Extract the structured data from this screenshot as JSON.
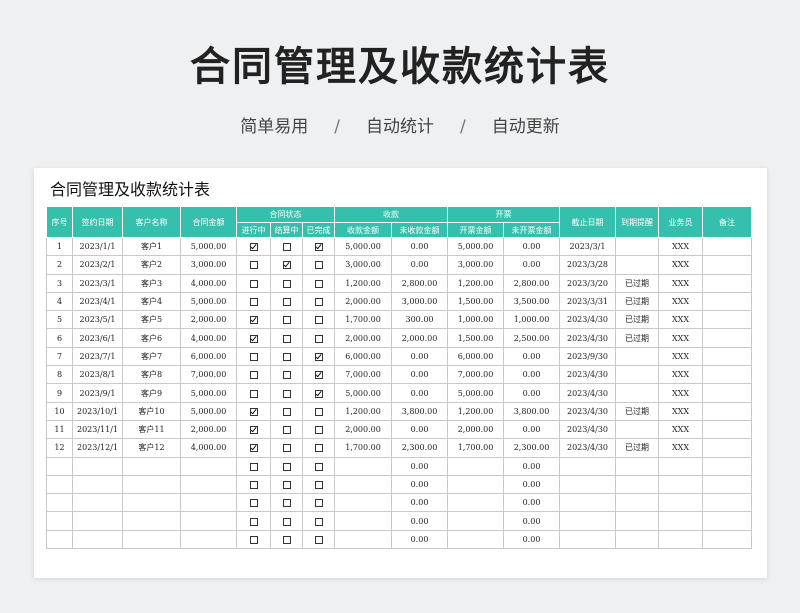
{
  "hero": {
    "title": "合同管理及收款统计表",
    "subtitle_items": [
      "简单易用",
      "自动统计",
      "自动更新"
    ],
    "separator": "/"
  },
  "sheet": {
    "title": "合同管理及收款统计表",
    "headers": {
      "seq": "序号",
      "sign_date": "签约日期",
      "customer": "客户名称",
      "contract_amount": "合同金额",
      "status_group": "合同状态",
      "status_in_progress": "进行中",
      "status_settling": "结算中",
      "status_done": "已完成",
      "receipt_group": "收款",
      "receipt_amount": "收款金额",
      "receipt_outstanding": "未收款金额",
      "invoice_group": "开票",
      "invoice_amount": "开票金额",
      "invoice_outstanding": "未开票金额",
      "deadline": "截止日期",
      "reminder": "到期提醒",
      "salesperson": "业务员",
      "remark": "备注"
    },
    "rows": [
      {
        "seq": "1",
        "date": "2023/1/1",
        "customer": "客户1",
        "amount": "5,000.00",
        "in_progress": true,
        "settling": false,
        "done": true,
        "received": "5,000.00",
        "unreceived": "0.00",
        "invoiced": "5,000.00",
        "uninvoiced": "0.00",
        "deadline": "2023/3/1",
        "reminder": "",
        "sales": "XXX",
        "remark": ""
      },
      {
        "seq": "2",
        "date": "2023/2/1",
        "customer": "客户2",
        "amount": "3,000.00",
        "in_progress": false,
        "settling": true,
        "done": false,
        "received": "3,000.00",
        "unreceived": "0.00",
        "invoiced": "3,000.00",
        "uninvoiced": "0.00",
        "deadline": "2023/3/28",
        "reminder": "",
        "sales": "XXX",
        "remark": ""
      },
      {
        "seq": "3",
        "date": "2023/3/1",
        "customer": "客户3",
        "amount": "4,000.00",
        "in_progress": false,
        "settling": false,
        "done": false,
        "received": "1,200.00",
        "unreceived": "2,800.00",
        "invoiced": "1,200.00",
        "uninvoiced": "2,800.00",
        "deadline": "2023/3/20",
        "reminder": "已过期",
        "sales": "XXX",
        "remark": ""
      },
      {
        "seq": "4",
        "date": "2023/4/1",
        "customer": "客户4",
        "amount": "5,000.00",
        "in_progress": false,
        "settling": false,
        "done": false,
        "received": "2,000.00",
        "unreceived": "3,000.00",
        "invoiced": "1,500.00",
        "uninvoiced": "3,500.00",
        "deadline": "2023/3/31",
        "reminder": "已过期",
        "sales": "XXX",
        "remark": ""
      },
      {
        "seq": "5",
        "date": "2023/5/1",
        "customer": "客户5",
        "amount": "2,000.00",
        "in_progress": true,
        "settling": false,
        "done": false,
        "received": "1,700.00",
        "unreceived": "300.00",
        "invoiced": "1,000.00",
        "uninvoiced": "1,000.00",
        "deadline": "2023/4/30",
        "reminder": "已过期",
        "sales": "XXX",
        "remark": ""
      },
      {
        "seq": "6",
        "date": "2023/6/1",
        "customer": "客户6",
        "amount": "4,000.00",
        "in_progress": true,
        "settling": false,
        "done": false,
        "received": "2,000.00",
        "unreceived": "2,000.00",
        "invoiced": "1,500.00",
        "uninvoiced": "2,500.00",
        "deadline": "2023/4/30",
        "reminder": "已过期",
        "sales": "XXX",
        "remark": ""
      },
      {
        "seq": "7",
        "date": "2023/7/1",
        "customer": "客户7",
        "amount": "6,000.00",
        "in_progress": false,
        "settling": false,
        "done": true,
        "received": "6,000.00",
        "unreceived": "0.00",
        "invoiced": "6,000.00",
        "uninvoiced": "0.00",
        "deadline": "2023/9/30",
        "reminder": "",
        "sales": "XXX",
        "remark": ""
      },
      {
        "seq": "8",
        "date": "2023/8/1",
        "customer": "客户8",
        "amount": "7,000.00",
        "in_progress": false,
        "settling": false,
        "done": true,
        "received": "7,000.00",
        "unreceived": "0.00",
        "invoiced": "7,000.00",
        "uninvoiced": "0.00",
        "deadline": "2023/4/30",
        "reminder": "",
        "sales": "XXX",
        "remark": ""
      },
      {
        "seq": "9",
        "date": "2023/9/1",
        "customer": "客户9",
        "amount": "5,000.00",
        "in_progress": false,
        "settling": false,
        "done": true,
        "received": "5,000.00",
        "unreceived": "0.00",
        "invoiced": "5,000.00",
        "uninvoiced": "0.00",
        "deadline": "2023/4/30",
        "reminder": "",
        "sales": "XXX",
        "remark": ""
      },
      {
        "seq": "10",
        "date": "2023/10/1",
        "customer": "客户10",
        "amount": "5,000.00",
        "in_progress": true,
        "settling": false,
        "done": false,
        "received": "1,200.00",
        "unreceived": "3,800.00",
        "invoiced": "1,200.00",
        "uninvoiced": "3,800.00",
        "deadline": "2023/4/30",
        "reminder": "已过期",
        "sales": "XXX",
        "remark": ""
      },
      {
        "seq": "11",
        "date": "2023/11/1",
        "customer": "客户11",
        "amount": "2,000.00",
        "in_progress": true,
        "settling": false,
        "done": false,
        "received": "2,000.00",
        "unreceived": "0.00",
        "invoiced": "2,000.00",
        "uninvoiced": "0.00",
        "deadline": "2023/4/30",
        "reminder": "",
        "sales": "XXX",
        "remark": ""
      },
      {
        "seq": "12",
        "date": "2023/12/1",
        "customer": "客户12",
        "amount": "4,000.00",
        "in_progress": true,
        "settling": false,
        "done": false,
        "received": "1,700.00",
        "unreceived": "2,300.00",
        "invoiced": "1,700.00",
        "uninvoiced": "2,300.00",
        "deadline": "2023/4/30",
        "reminder": "已过期",
        "sales": "XXX",
        "remark": ""
      }
    ],
    "empty_row_count": 5,
    "empty_row_zero": "0.00"
  }
}
